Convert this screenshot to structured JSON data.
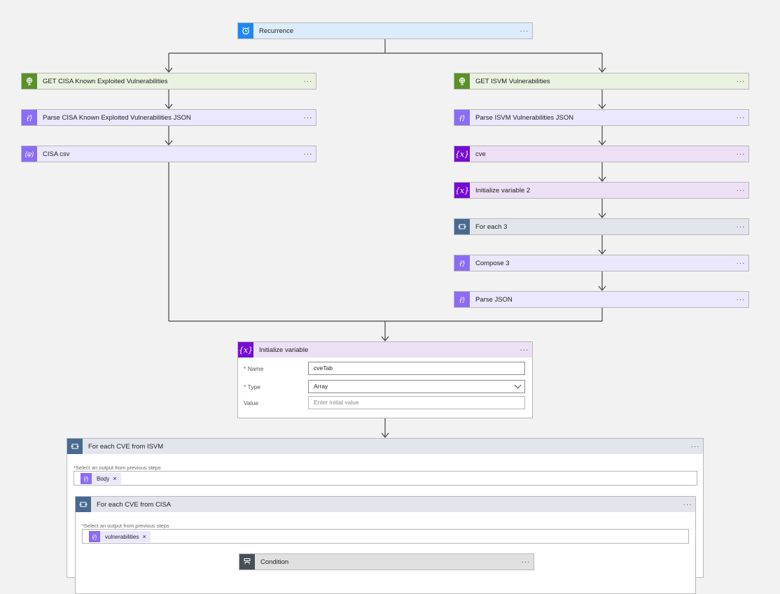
{
  "nodes": {
    "recurrence": "Recurrence",
    "get_cisa": "GET CISA Known Exploited Vulnerabilities",
    "parse_cisa": "Parse CISA Known Exploited Vulnerabilities JSON",
    "cisa_csv": "CISA csv",
    "get_isvm": "GET ISVM Vulnerabilities",
    "parse_isvm": "Parse ISVM Vulnerabilities JSON",
    "cve": "cve",
    "init_var2": "Initialize variable 2",
    "for_each3": "For each 3",
    "compose3": "Compose 3",
    "parse_json": "Parse JSON",
    "condition": "Condition"
  },
  "more_menu": "···",
  "init_variable": {
    "title": "Initialize variable",
    "name_label": "Name",
    "name_value": "cveTab",
    "type_label": "Type",
    "type_value": "Array",
    "value_label": "Value",
    "value_placeholder": "Enter initial value",
    "required_mark": "*"
  },
  "loop_isvm": {
    "title": "For each CVE from ISVM",
    "select_label": "Select an output from previous steps",
    "token": "Body"
  },
  "loop_cisa": {
    "title": "For each CVE from CISA",
    "select_label": "Select an output from previous steps",
    "token": "vulnerabilities"
  },
  "token_remove": "×",
  "icons": {
    "recurrence": "alarm-clock-icon",
    "http": "globe-icon",
    "parse": "braces-icon",
    "variable": "variable-x-icon",
    "loop": "loop-icon",
    "condition": "condition-icon"
  },
  "colors": {
    "blue": "#2088ee",
    "green": "#5b8f2c",
    "purple": "#8c6cf2",
    "variable": "#770bd6",
    "loop": "#486991"
  }
}
